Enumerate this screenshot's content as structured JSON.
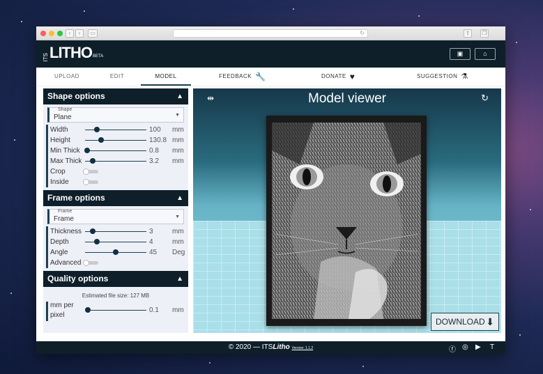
{
  "app": {
    "logo_its": "ITS",
    "logo_litho": "LITHO",
    "logo_beta": "BETA"
  },
  "tabs": [
    {
      "label": "UPLOAD"
    },
    {
      "label": "EDIT"
    },
    {
      "label": "MODEL",
      "active": true
    }
  ],
  "nav": {
    "feedback": "FEEDBACK",
    "donate": "DONATE",
    "suggestion": "SUGGESTION"
  },
  "shape_options": {
    "title": "Shape options",
    "select_label": "Shape",
    "select_value": "Plane",
    "rows": [
      {
        "label": "Width",
        "value": "100",
        "unit": "mm",
        "fraction": 0.19
      },
      {
        "label": "Height",
        "value": "130.8",
        "unit": "mm",
        "fraction": 0.26
      },
      {
        "label": "Min Thick",
        "value": "0.8",
        "unit": "mm",
        "fraction": 0.03
      },
      {
        "label": "Max Thick",
        "value": "3.2",
        "unit": "mm",
        "fraction": 0.13
      }
    ],
    "toggles": [
      {
        "label": "Crop",
        "on": false
      },
      {
        "label": "Inside",
        "on": false
      }
    ]
  },
  "frame_options": {
    "title": "Frame options",
    "select_label": "Frame",
    "select_value": "Frame",
    "rows": [
      {
        "label": "Thickness",
        "value": "3",
        "unit": "mm",
        "fraction": 0.13
      },
      {
        "label": "Depth",
        "value": "4",
        "unit": "mm",
        "fraction": 0.19
      },
      {
        "label": "Angle",
        "value": "45",
        "unit": "Deg",
        "fraction": 0.5
      }
    ],
    "toggles": [
      {
        "label": "Advanced",
        "on": false
      }
    ]
  },
  "quality_options": {
    "title": "Quality options",
    "estimate": "Estimated file size: 127 MB",
    "row_label_1": "mm per",
    "row_label_2": "pixel",
    "value": "0.1",
    "unit": "mm",
    "fraction": 0.05
  },
  "viewer": {
    "title": "Model viewer",
    "download": "DOWNLOAD"
  },
  "footer": {
    "copyright": "© 2020 — ITS",
    "brand": "Litho",
    "version": "Version: 1.1.2"
  },
  "colors": {
    "primary": "#0e1f2a",
    "accent": "#1e4052"
  }
}
